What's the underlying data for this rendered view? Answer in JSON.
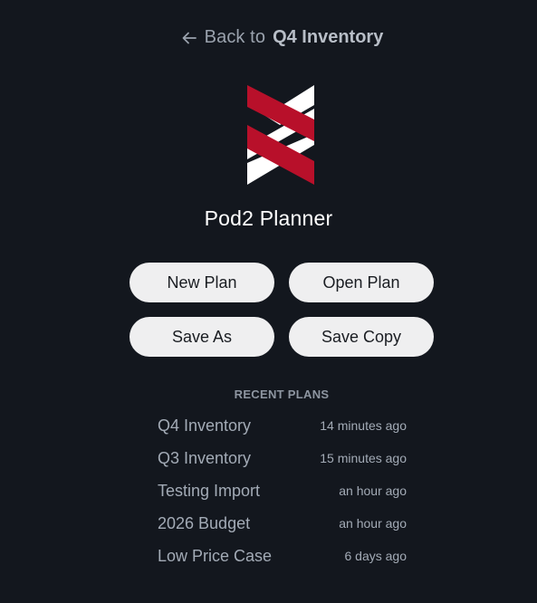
{
  "back_link": {
    "prefix": "Back to",
    "target": "Q4 Inventory",
    "icon": "arrow-left-icon"
  },
  "logo": {
    "icon": "crossed-stripes-logo",
    "colors": {
      "red": "#b8102a",
      "white": "#ffffff"
    }
  },
  "app": {
    "title": "Pod2 Planner"
  },
  "actions": {
    "new_plan": "New Plan",
    "open_plan": "Open Plan",
    "save_as": "Save As",
    "save_copy": "Save Copy"
  },
  "recent": {
    "heading": "RECENT PLANS",
    "items": [
      {
        "name": "Q4 Inventory",
        "time": "14 minutes ago"
      },
      {
        "name": "Q3 Inventory",
        "time": "15 minutes ago"
      },
      {
        "name": "Testing Import",
        "time": "an hour ago"
      },
      {
        "name": "2026 Budget",
        "time": "an hour ago"
      },
      {
        "name": "Low Price Case",
        "time": "6 days ago"
      }
    ]
  },
  "colors": {
    "background": "#13171e",
    "button_bg": "#efeff0",
    "muted_text": "#9aa2ad"
  }
}
